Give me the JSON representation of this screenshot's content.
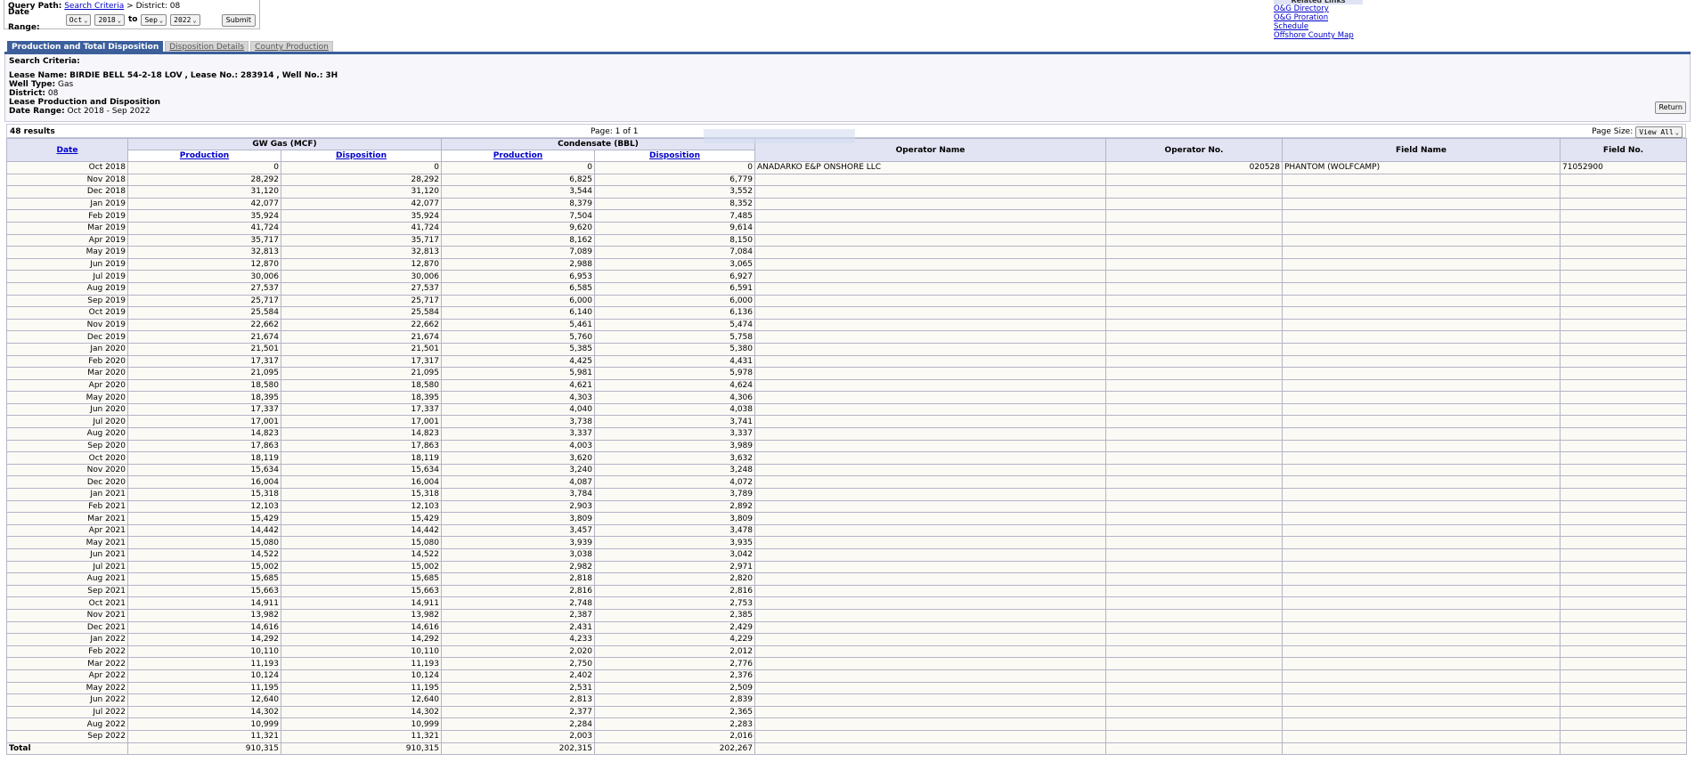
{
  "query_path": {
    "label": "Query Path:",
    "link": "Search Criteria",
    "sep": ">",
    "rest": "District: 08"
  },
  "date_range_form": {
    "label": "Date Range:",
    "from_month": "Oct",
    "from_year": "2018",
    "to_label": "to",
    "to_month": "Sep",
    "to_year": "2022",
    "submit": "Submit"
  },
  "related_links": {
    "header": "Related Links",
    "links": [
      "O&G Directory",
      "O&G Proration Schedule",
      "Offshore County Map"
    ]
  },
  "tabs": [
    "Production and Total Disposition",
    "Disposition Details",
    "County Production"
  ],
  "criteria": {
    "title": "Search Criteria:",
    "lease_name_label": "Lease Name:",
    "lease_name": "BIRDIE BELL 54-2-18 LOV",
    "lease_no_label": "Lease No.:",
    "lease_no": "283914",
    "well_no_label": "Well No.:",
    "well_no": "3H",
    "well_type_label": "Well Type:",
    "well_type": "Gas",
    "district_label": "District:",
    "district": "08",
    "report_label": "Lease Production and Disposition",
    "date_range_label": "Date Range:",
    "date_range": "Oct 2018 - Sep 2022",
    "return_button": "Return"
  },
  "table_bar": {
    "results": "48 results",
    "pager": "Page: 1 of 1",
    "page_size_label": "Page Size:",
    "page_size": "View All"
  },
  "table": {
    "headers": {
      "date": "Date",
      "gw_gas": "GW Gas (MCF)",
      "condensate": "Condensate (BBL)",
      "production": "Production",
      "disposition": "Disposition",
      "operator_name": "Operator Name",
      "operator_no": "Operator No.",
      "field_name": "Field Name",
      "field_no": "Field No."
    },
    "rows": [
      [
        "Oct 2018",
        "0",
        "0",
        "0",
        "0",
        "ANADARKO E&P ONSHORE LLC",
        "020528",
        "PHANTOM (WOLFCAMP)",
        "71052900"
      ],
      [
        "Nov 2018",
        "28,292",
        "28,292",
        "6,825",
        "6,779",
        "",
        "",
        "",
        ""
      ],
      [
        "Dec 2018",
        "31,120",
        "31,120",
        "3,544",
        "3,552",
        "",
        "",
        "",
        ""
      ],
      [
        "Jan 2019",
        "42,077",
        "42,077",
        "8,379",
        "8,352",
        "",
        "",
        "",
        ""
      ],
      [
        "Feb 2019",
        "35,924",
        "35,924",
        "7,504",
        "7,485",
        "",
        "",
        "",
        ""
      ],
      [
        "Mar 2019",
        "41,724",
        "41,724",
        "9,620",
        "9,614",
        "",
        "",
        "",
        ""
      ],
      [
        "Apr 2019",
        "35,717",
        "35,717",
        "8,162",
        "8,150",
        "",
        "",
        "",
        ""
      ],
      [
        "May 2019",
        "32,813",
        "32,813",
        "7,089",
        "7,084",
        "",
        "",
        "",
        ""
      ],
      [
        "Jun 2019",
        "12,870",
        "12,870",
        "2,988",
        "3,065",
        "",
        "",
        "",
        ""
      ],
      [
        "Jul 2019",
        "30,006",
        "30,006",
        "6,953",
        "6,927",
        "",
        "",
        "",
        ""
      ],
      [
        "Aug 2019",
        "27,537",
        "27,537",
        "6,585",
        "6,591",
        "",
        "",
        "",
        ""
      ],
      [
        "Sep 2019",
        "25,717",
        "25,717",
        "6,000",
        "6,000",
        "",
        "",
        "",
        ""
      ],
      [
        "Oct 2019",
        "25,584",
        "25,584",
        "6,140",
        "6,136",
        "",
        "",
        "",
        ""
      ],
      [
        "Nov 2019",
        "22,662",
        "22,662",
        "5,461",
        "5,474",
        "",
        "",
        "",
        ""
      ],
      [
        "Dec 2019",
        "21,674",
        "21,674",
        "5,760",
        "5,758",
        "",
        "",
        "",
        ""
      ],
      [
        "Jan 2020",
        "21,501",
        "21,501",
        "5,385",
        "5,380",
        "",
        "",
        "",
        ""
      ],
      [
        "Feb 2020",
        "17,317",
        "17,317",
        "4,425",
        "4,431",
        "",
        "",
        "",
        ""
      ],
      [
        "Mar 2020",
        "21,095",
        "21,095",
        "5,981",
        "5,978",
        "",
        "",
        "",
        ""
      ],
      [
        "Apr 2020",
        "18,580",
        "18,580",
        "4,621",
        "4,624",
        "",
        "",
        "",
        ""
      ],
      [
        "May 2020",
        "18,395",
        "18,395",
        "4,303",
        "4,306",
        "",
        "",
        "",
        ""
      ],
      [
        "Jun 2020",
        "17,337",
        "17,337",
        "4,040",
        "4,038",
        "",
        "",
        "",
        ""
      ],
      [
        "Jul 2020",
        "17,001",
        "17,001",
        "3,738",
        "3,741",
        "",
        "",
        "",
        ""
      ],
      [
        "Aug 2020",
        "14,823",
        "14,823",
        "3,337",
        "3,337",
        "",
        "",
        "",
        ""
      ],
      [
        "Sep 2020",
        "17,863",
        "17,863",
        "4,003",
        "3,989",
        "",
        "",
        "",
        ""
      ],
      [
        "Oct 2020",
        "18,119",
        "18,119",
        "3,620",
        "3,632",
        "",
        "",
        "",
        ""
      ],
      [
        "Nov 2020",
        "15,634",
        "15,634",
        "3,240",
        "3,248",
        "",
        "",
        "",
        ""
      ],
      [
        "Dec 2020",
        "16,004",
        "16,004",
        "4,087",
        "4,072",
        "",
        "",
        "",
        ""
      ],
      [
        "Jan 2021",
        "15,318",
        "15,318",
        "3,784",
        "3,789",
        "",
        "",
        "",
        ""
      ],
      [
        "Feb 2021",
        "12,103",
        "12,103",
        "2,903",
        "2,892",
        "",
        "",
        "",
        ""
      ],
      [
        "Mar 2021",
        "15,429",
        "15,429",
        "3,809",
        "3,809",
        "",
        "",
        "",
        ""
      ],
      [
        "Apr 2021",
        "14,442",
        "14,442",
        "3,457",
        "3,478",
        "",
        "",
        "",
        ""
      ],
      [
        "May 2021",
        "15,080",
        "15,080",
        "3,939",
        "3,935",
        "",
        "",
        "",
        ""
      ],
      [
        "Jun 2021",
        "14,522",
        "14,522",
        "3,038",
        "3,042",
        "",
        "",
        "",
        ""
      ],
      [
        "Jul 2021",
        "15,002",
        "15,002",
        "2,982",
        "2,971",
        "",
        "",
        "",
        ""
      ],
      [
        "Aug 2021",
        "15,685",
        "15,685",
        "2,818",
        "2,820",
        "",
        "",
        "",
        ""
      ],
      [
        "Sep 2021",
        "15,663",
        "15,663",
        "2,816",
        "2,816",
        "",
        "",
        "",
        ""
      ],
      [
        "Oct 2021",
        "14,911",
        "14,911",
        "2,748",
        "2,753",
        "",
        "",
        "",
        ""
      ],
      [
        "Nov 2021",
        "13,982",
        "13,982",
        "2,387",
        "2,385",
        "",
        "",
        "",
        ""
      ],
      [
        "Dec 2021",
        "14,616",
        "14,616",
        "2,431",
        "2,429",
        "",
        "",
        "",
        ""
      ],
      [
        "Jan 2022",
        "14,292",
        "14,292",
        "4,233",
        "4,229",
        "",
        "",
        "",
        ""
      ],
      [
        "Feb 2022",
        "10,110",
        "10,110",
        "2,020",
        "2,012",
        "",
        "",
        "",
        ""
      ],
      [
        "Mar 2022",
        "11,193",
        "11,193",
        "2,750",
        "2,776",
        "",
        "",
        "",
        ""
      ],
      [
        "Apr 2022",
        "10,124",
        "10,124",
        "2,402",
        "2,376",
        "",
        "",
        "",
        ""
      ],
      [
        "May 2022",
        "11,195",
        "11,195",
        "2,531",
        "2,509",
        "",
        "",
        "",
        ""
      ],
      [
        "Jun 2022",
        "12,640",
        "12,640",
        "2,813",
        "2,839",
        "",
        "",
        "",
        ""
      ],
      [
        "Jul 2022",
        "14,302",
        "14,302",
        "2,377",
        "2,365",
        "",
        "",
        "",
        ""
      ],
      [
        "Aug 2022",
        "10,999",
        "10,999",
        "2,284",
        "2,283",
        "",
        "",
        "",
        ""
      ],
      [
        "Sep 2022",
        "11,321",
        "11,321",
        "2,003",
        "2,016",
        "",
        "",
        "",
        ""
      ]
    ],
    "total": [
      "Total",
      "910,315",
      "910,315",
      "202,315",
      "202,267",
      "",
      "",
      "",
      ""
    ]
  },
  "colors": {
    "tab_active": "#3c5f9c",
    "header_bg": "#e2e4f3",
    "row_bg": "#fbfaf5",
    "link": "#0000cc"
  }
}
